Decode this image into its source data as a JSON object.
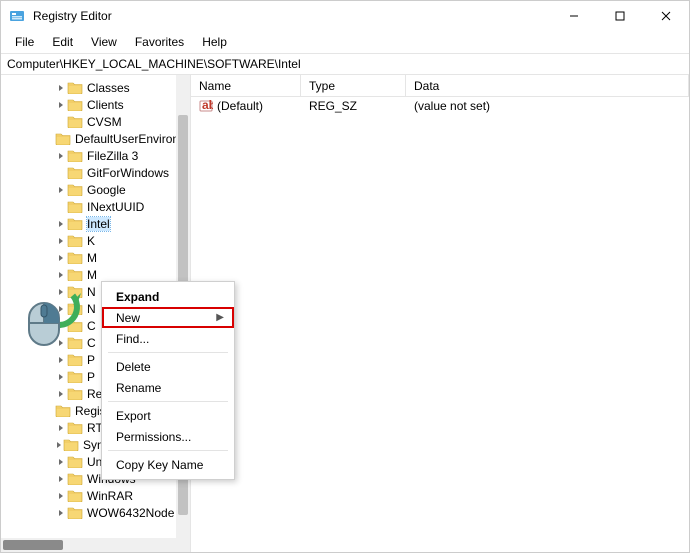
{
  "window": {
    "title": "Registry Editor"
  },
  "menu": {
    "file": "File",
    "edit": "Edit",
    "view": "View",
    "favorites": "Favorites",
    "help": "Help"
  },
  "address": {
    "path": "Computer\\HKEY_LOCAL_MACHINE\\SOFTWARE\\Intel"
  },
  "tree": {
    "items": [
      {
        "label": "Classes",
        "depth": 3
      },
      {
        "label": "Clients",
        "depth": 3
      },
      {
        "label": "CVSM",
        "depth": 3,
        "noCaret": true
      },
      {
        "label": "DefaultUserEnvironment",
        "depth": 3,
        "noCaret": true
      },
      {
        "label": "FileZilla 3",
        "depth": 3
      },
      {
        "label": "GitForWindows",
        "depth": 3,
        "noCaret": true
      },
      {
        "label": "Google",
        "depth": 3
      },
      {
        "label": "INextUUID",
        "depth": 3,
        "noCaret": true
      },
      {
        "label": "Intel",
        "depth": 3,
        "selected": true
      },
      {
        "label": "K",
        "depth": 3
      },
      {
        "label": "M",
        "depth": 3
      },
      {
        "label": "M",
        "depth": 3
      },
      {
        "label": "N",
        "depth": 3
      },
      {
        "label": "N",
        "depth": 3
      },
      {
        "label": "C",
        "depth": 3
      },
      {
        "label": "C",
        "depth": 3
      },
      {
        "label": "P",
        "depth": 3
      },
      {
        "label": "P",
        "depth": 3
      },
      {
        "label": "Realtek",
        "depth": 3
      },
      {
        "label": "RegisteredApplications",
        "depth": 3,
        "noCaret": true
      },
      {
        "label": "RTLSetup",
        "depth": 3
      },
      {
        "label": "SyncIntegrationClients",
        "depth": 3
      },
      {
        "label": "Unity Technologies",
        "depth": 3
      },
      {
        "label": "Windows",
        "depth": 3
      },
      {
        "label": "WinRAR",
        "depth": 3
      },
      {
        "label": "WOW6432Node",
        "depth": 3
      }
    ]
  },
  "list": {
    "headers": {
      "name": "Name",
      "type": "Type",
      "data": "Data"
    },
    "rows": [
      {
        "name": "(Default)",
        "type": "REG_SZ",
        "data": "(value not set)"
      }
    ]
  },
  "context": {
    "expand": "Expand",
    "new": "New",
    "find": "Find...",
    "delete": "Delete",
    "rename": "Rename",
    "export": "Export",
    "permissions": "Permissions...",
    "copykey": "Copy Key Name"
  }
}
